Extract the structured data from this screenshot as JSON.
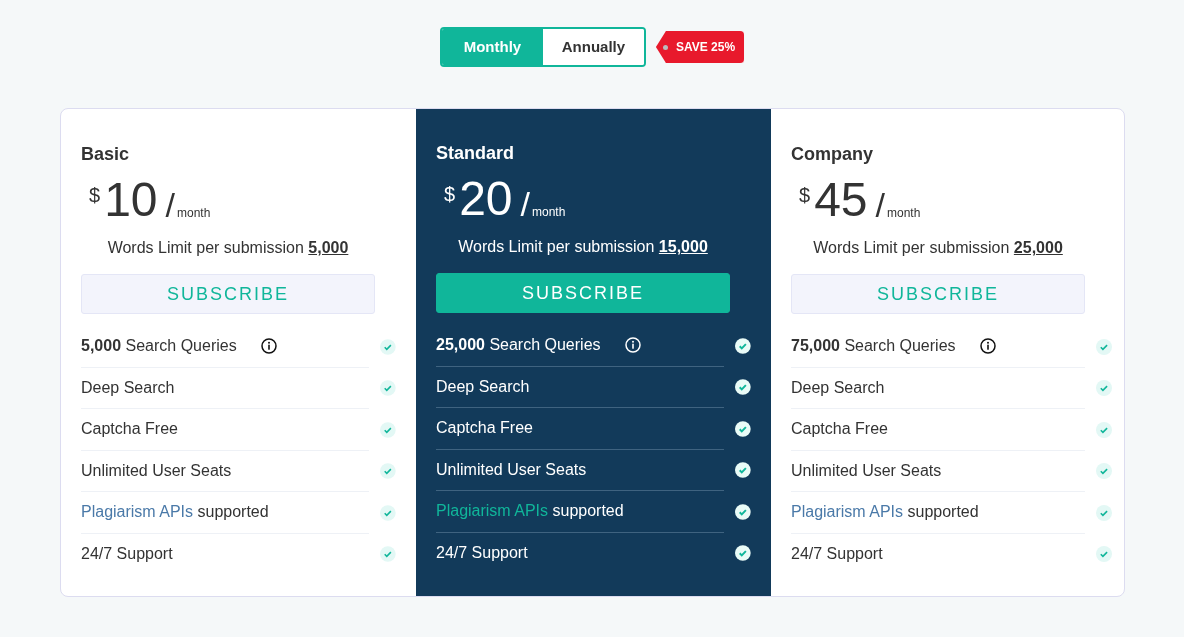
{
  "billing_toggle": [
    {
      "label": "Monthly",
      "selected": true
    },
    {
      "label": "Annually",
      "selected": false
    }
  ],
  "discount_tag": "SAVE 25%",
  "plans": [
    {
      "name": "Basic",
      "featured": false,
      "currency": "$",
      "price": "10",
      "separator": "/",
      "period": "month",
      "words_limit_label": "Words Limit per submission",
      "words_limit": "5,000",
      "button": "SUBSCRIBE",
      "features": [
        {
          "kind": "count",
          "count": "5,000",
          "text": "Search Queries",
          "included": true
        },
        {
          "kind": "plain",
          "text": "Deep Search",
          "included": true
        },
        {
          "kind": "plain",
          "text": "Captcha Free",
          "included": true
        },
        {
          "kind": "plain",
          "text": "Unlimited User Seats",
          "included": true
        },
        {
          "kind": "link",
          "link": "Plagiarism APIs",
          "text": "supported",
          "included": true
        },
        {
          "kind": "plain",
          "text": "24/7 Support",
          "included": true
        }
      ]
    },
    {
      "name": "Standard",
      "featured": true,
      "currency": "$",
      "price": "20",
      "separator": "/",
      "period": "month",
      "words_limit_label": "Words Limit per submission",
      "words_limit": "15,000",
      "button": "SUBSCRIBE",
      "features": [
        {
          "kind": "count",
          "count": "25,000",
          "text": "Search Queries",
          "included": true
        },
        {
          "kind": "plain",
          "text": "Deep Search",
          "included": true
        },
        {
          "kind": "plain",
          "text": "Captcha Free",
          "included": true
        },
        {
          "kind": "plain",
          "text": "Unlimited User Seats",
          "included": true
        },
        {
          "kind": "link",
          "link": "Plagiarism APIs",
          "text": "supported",
          "included": true
        },
        {
          "kind": "plain",
          "text": "24/7 Support",
          "included": true
        }
      ]
    },
    {
      "name": "Company",
      "featured": false,
      "currency": "$",
      "price": "45",
      "separator": "/",
      "period": "month",
      "words_limit_label": "Words Limit per submission",
      "words_limit": "25,000",
      "button": "SUBSCRIBE",
      "features": [
        {
          "kind": "count",
          "count": "75,000",
          "text": "Search Queries",
          "included": true
        },
        {
          "kind": "plain",
          "text": "Deep Search",
          "included": true
        },
        {
          "kind": "plain",
          "text": "Captcha Free",
          "included": true
        },
        {
          "kind": "plain",
          "text": "Unlimited User Seats",
          "included": true
        },
        {
          "kind": "link",
          "link": "Plagiarism APIs",
          "text": "supported",
          "included": true
        },
        {
          "kind": "plain",
          "text": "24/7 Support",
          "included": true
        }
      ]
    }
  ]
}
